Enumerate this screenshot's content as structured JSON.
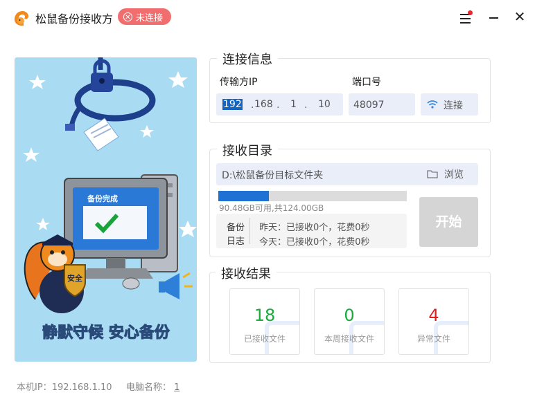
{
  "app": {
    "title": "松鼠备份接收方",
    "status": "未连接",
    "status_color": "#f26d6d"
  },
  "illustration": {
    "screen_text": "备份完成",
    "shield_text": "安全",
    "slogan": "静默守候 安心备份"
  },
  "connection": {
    "title": "连接信息",
    "ip_label": "传输方IP",
    "ip": [
      "192",
      "168",
      "1",
      "10"
    ],
    "port_label": "端口号",
    "port": "48097",
    "connect_label": "连接"
  },
  "directory": {
    "title": "接收目录",
    "path": "D:\\松鼠备份目标文件夹",
    "browse_label": "浏览",
    "disk_usage_fraction": 0.27,
    "disk_text": "90.48GB可用,共124.00GB",
    "log_label_1": "备份",
    "log_label_2": "日志",
    "log_yesterday": "昨天：已接收0个，花费0秒",
    "log_today": "今天：已接收0个，花费0秒",
    "start_label": "开始"
  },
  "results": {
    "title": "接收结果",
    "stats": [
      {
        "value": "18",
        "label": "已接收文件",
        "color": "#1aab3d"
      },
      {
        "value": "0",
        "label": "本周接收文件",
        "color": "#1aab3d"
      },
      {
        "value": "4",
        "label": "异常文件",
        "color": "#e02020"
      }
    ]
  },
  "footer": {
    "ip_label": "本机IP：",
    "ip_value": "192.168.1.10",
    "pc_label": "电脑名称：",
    "pc_value": "1"
  },
  "icons": {
    "status": "close-circle-icon",
    "menu": "hamburger-menu-icon",
    "connect": "wifi-icon",
    "browse": "folder-icon"
  },
  "colors": {
    "accent": "#1f72d4",
    "field_bg": "#e9eef9",
    "illustration_bg": "#a9dcf2"
  }
}
